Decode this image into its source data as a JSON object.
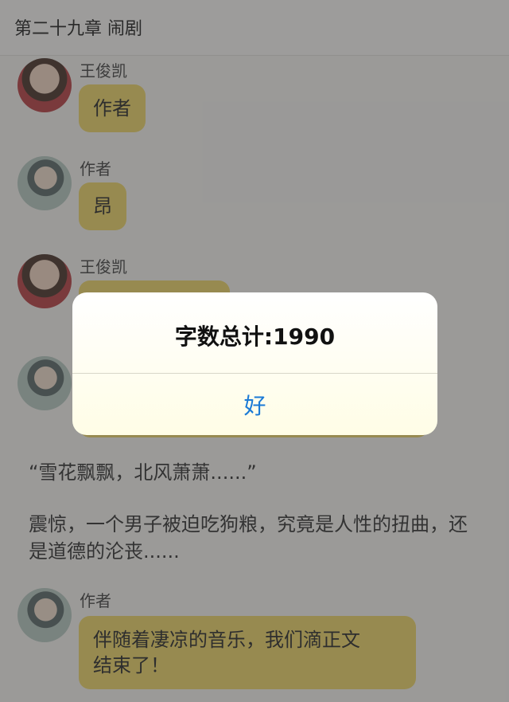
{
  "header": {
    "title": "第二十九章 闹剧"
  },
  "messages": [
    {
      "sender": "王俊凯",
      "text": "作者",
      "avatar": "boy-avatar"
    },
    {
      "sender": "作者",
      "text": "昂",
      "avatar": "girl-avatar"
    },
    {
      "sender": "王俊凯",
      "text": "",
      "avatar": "boy-avatar"
    },
    {
      "sender": "",
      "text": "",
      "avatar": "girl-avatar"
    },
    {
      "sender": "作者",
      "text": "伴随着凄凉的音乐，我们滴正文\n结束了！",
      "avatar": "girl-avatar"
    }
  ],
  "narration": {
    "line1": "“雪花飘飘，北风萧萧......”",
    "line2": "震惊，一个男子被迫吃狗粮，究竟是人性的扭曲，还是道德的沦丧......"
  },
  "alert": {
    "title": "字数总计:1990",
    "button": "好"
  },
  "colors": {
    "bubble": "#f0d86b",
    "alert_button": "#1b7ad6",
    "overlay": "rgba(50,50,50,0.47)"
  }
}
